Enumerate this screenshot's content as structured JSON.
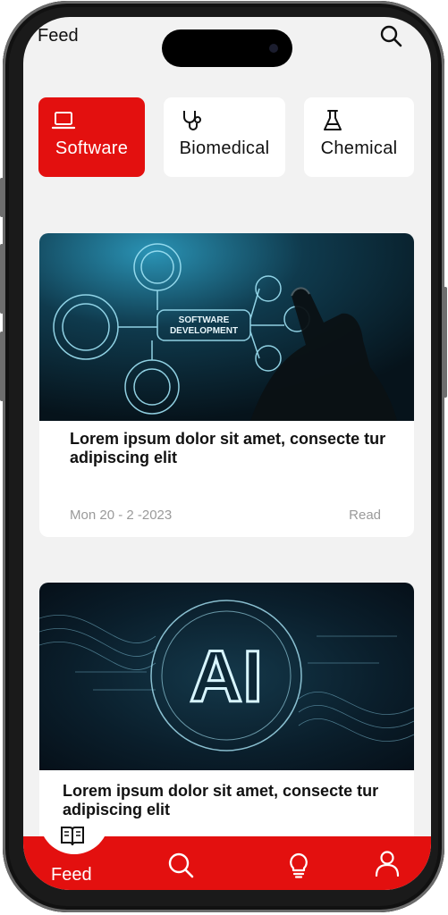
{
  "header": {
    "title": "Feed",
    "search_icon": "search-icon"
  },
  "categories": [
    {
      "label": "Software",
      "icon": "laptop-icon",
      "active": true
    },
    {
      "label": "Biomedical",
      "icon": "stethoscope-icon",
      "active": false
    },
    {
      "label": "Chemical",
      "icon": "flask-icon",
      "active": false
    }
  ],
  "articles": [
    {
      "image_text": [
        "SOFTWARE",
        "DEVELOPMENT"
      ],
      "title": "Lorem ipsum dolor sit amet, consecte tur adipiscing elit",
      "date": "Mon 20 - 2 -2023",
      "action": "Read"
    },
    {
      "image_text": [
        "AI"
      ],
      "title": "Lorem ipsum dolor sit amet, consecte tur adipiscing elit"
    }
  ],
  "bottom_nav": [
    {
      "label": "Feed",
      "icon": "book-icon",
      "active": true
    },
    {
      "label": "",
      "icon": "search-icon"
    },
    {
      "label": "",
      "icon": "lightbulb-icon"
    },
    {
      "label": "",
      "icon": "user-icon"
    }
  ],
  "colors": {
    "accent": "#e3100f",
    "background": "#f2f2f2",
    "card": "#ffffff",
    "muted_text": "#9a9a9a"
  }
}
